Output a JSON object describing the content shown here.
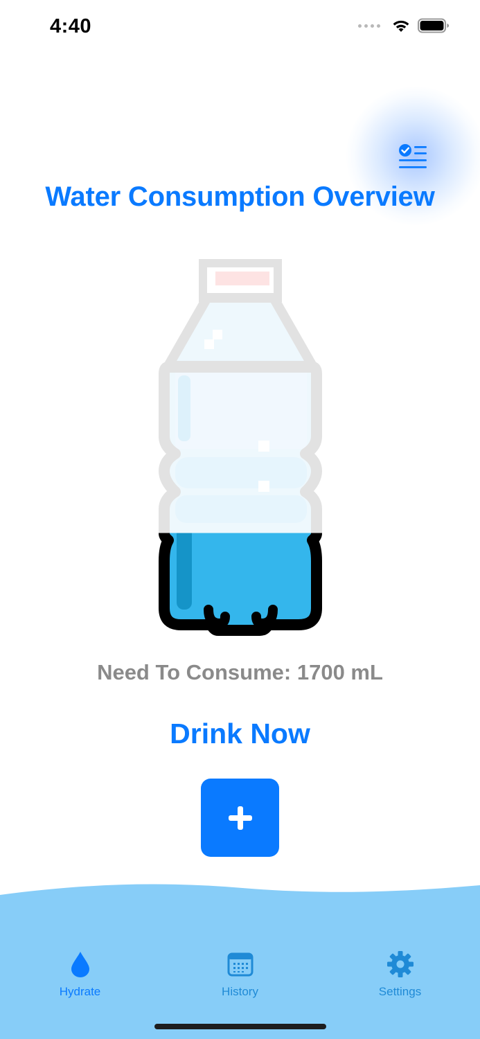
{
  "status_bar": {
    "time": "4:40"
  },
  "header": {
    "title": "Water Consumption Overview",
    "report_icon": "checklist-icon"
  },
  "bottle": {
    "fill_level": 0.3,
    "icon": "water-bottle-icon"
  },
  "main": {
    "need_to_consume": "Need To Consume: 1700 mL",
    "drink_now_label": "Drink Now",
    "add_label": "+"
  },
  "tabs": [
    {
      "label": "Hydrate",
      "icon": "water-drop-icon",
      "selected": true
    },
    {
      "label": "History",
      "icon": "calendar-icon",
      "selected": false
    },
    {
      "label": "Settings",
      "icon": "gear-icon",
      "selected": false
    }
  ],
  "colors": {
    "accent": "#0a7aff",
    "water": "#34b6ec",
    "wave": "#87cdf8",
    "tab_active": "#0a7aff",
    "tab_inactive": "#1f8ad6",
    "secondary_text": "#8a8a8a"
  }
}
